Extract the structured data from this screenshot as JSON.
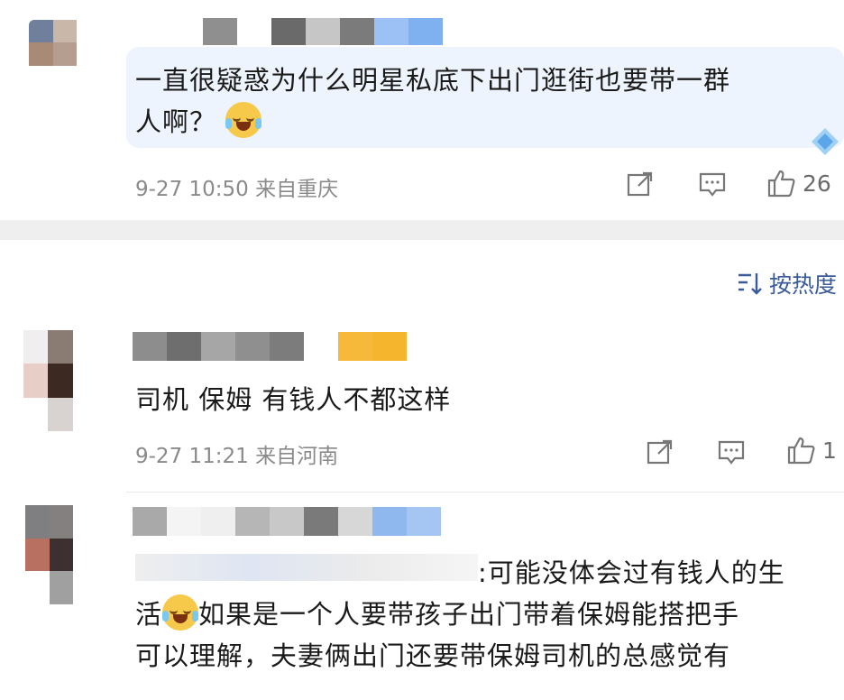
{
  "top_comment": {
    "text_line1": "一直很疑惑为什么明星私底下出门逛街也要带一群",
    "text_line2": "人啊？",
    "emoji": "laughing-crying-emoji",
    "time": "9-27 10:50",
    "location": "来自重庆",
    "likes": "26",
    "highlight_color": "#eef4fd"
  },
  "sort": {
    "label": "按热度"
  },
  "comments": [
    {
      "text": "司机 保姆 有钱人不都这样",
      "time": "9-27 11:21",
      "location": "来自河南",
      "likes": "1"
    },
    {
      "reply_prefix": ":可能没体会过有钱人的生",
      "line2_after_emoji": "如果是一个人要带孩子出门带着保姆能搭把手",
      "line2_start": "活",
      "line3": "可以理解，夫妻俩出门还要带保姆司机的总感觉有"
    }
  ],
  "colors": {
    "accent": "#3a5a9a",
    "meta_gray": "#8a8a8a",
    "divider": "#efefef"
  }
}
